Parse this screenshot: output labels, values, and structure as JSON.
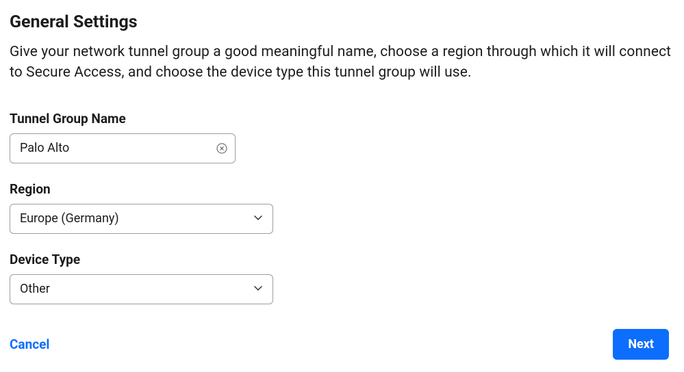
{
  "header": {
    "title": "General Settings",
    "description": "Give your network tunnel group a good meaningful name, choose a region through which it will connect to Secure Access, and choose the device type this tunnel group will use."
  },
  "form": {
    "tunnelGroupName": {
      "label": "Tunnel Group Name",
      "value": "Palo Alto"
    },
    "region": {
      "label": "Region",
      "value": "Europe (Germany)"
    },
    "deviceType": {
      "label": "Device Type",
      "value": "Other"
    }
  },
  "footer": {
    "cancel": "Cancel",
    "next": "Next"
  }
}
